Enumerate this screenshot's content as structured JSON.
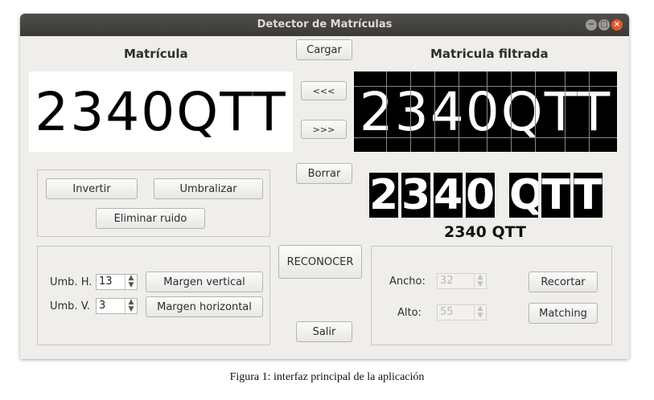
{
  "window": {
    "title": "Detector de Matrículas"
  },
  "left_panel": {
    "heading": "Matrícula",
    "plate_text": "2340QTT"
  },
  "center": {
    "cargar": "Cargar",
    "prev": "<<<",
    "next": ">>>",
    "borrar": "Borrar",
    "reconocer": "RECONOCER",
    "salir": "Salir"
  },
  "right_panel": {
    "heading": "Matricula filtrada",
    "plate_text": "2340QTT",
    "segments": [
      "2",
      "3",
      "4",
      "0",
      "Q",
      "T",
      "T"
    ],
    "result": "2340 QTT"
  },
  "process_group": {
    "invertir": "Invertir",
    "umbralizar": "Umbralizar",
    "eliminar_ruido": "Eliminar ruido"
  },
  "margins_group": {
    "umb_h_label": "Umb. H.",
    "umb_h_value": "13",
    "umb_v_label": "Umb. V.",
    "umb_v_value": "3",
    "margen_vertical": "Margen vertical",
    "margen_horizontal": "Margen horizontal"
  },
  "crop_group": {
    "ancho_label": "Ancho:",
    "ancho_value": "32",
    "alto_label": "Alto:",
    "alto_value": "55",
    "recortar": "Recortar",
    "matching": "Matching"
  },
  "caption": "Figura 1: interfaz principal de la aplicación"
}
